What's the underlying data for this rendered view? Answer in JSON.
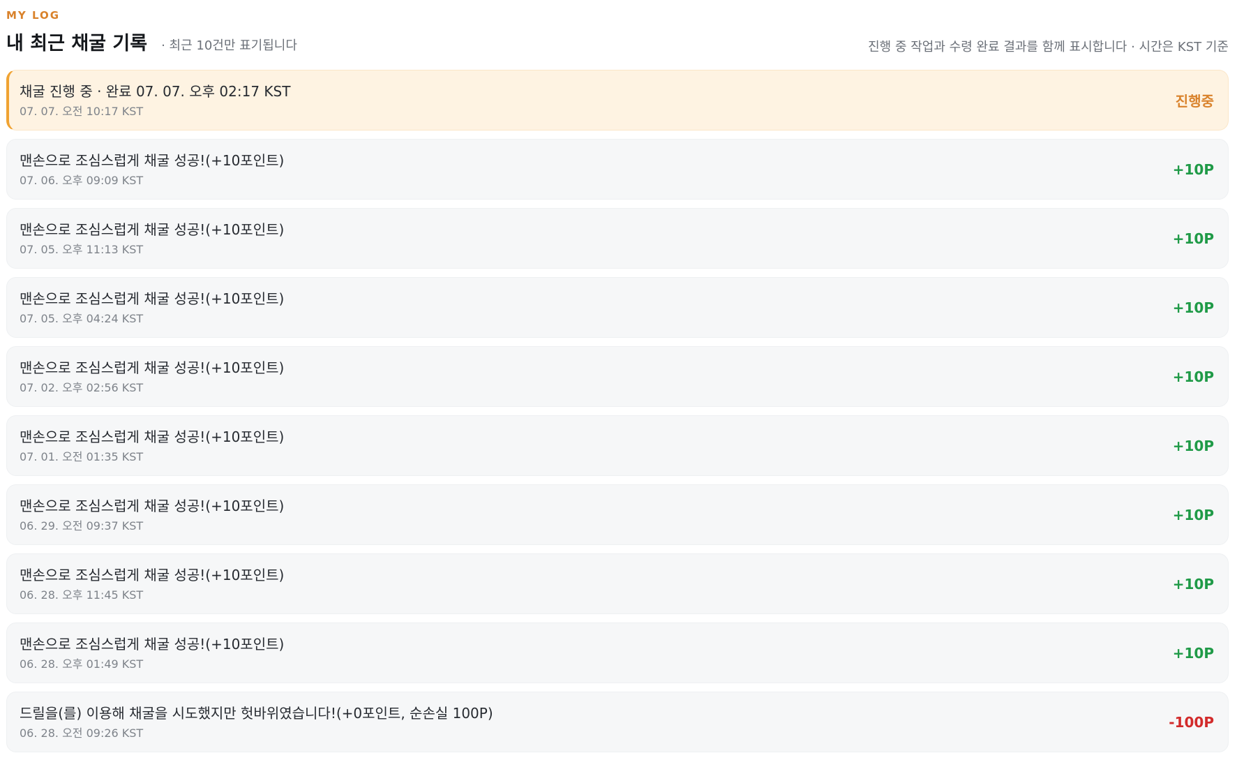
{
  "header": {
    "eyebrow": "MY LOG",
    "title": "내 최근 채굴 기록",
    "note": "· 최근 10건만 표기됩니다",
    "right_note": "진행 중 작업과 수령 완료 결과를 함께 표시합니다 · 시간은 KST 기준"
  },
  "logs": [
    {
      "message": "채굴 진행 중 · 완료 07. 07. 오후 02:17 KST",
      "time": "07. 07. 오전 10:17 KST",
      "badge": "진행중",
      "status": "in-progress"
    },
    {
      "message": "맨손으로 조심스럽게 채굴 성공!(+10포인트)",
      "time": "07. 06. 오후 09:09 KST",
      "badge": "+10P",
      "status": "plus"
    },
    {
      "message": "맨손으로 조심스럽게 채굴 성공!(+10포인트)",
      "time": "07. 05. 오후 11:13 KST",
      "badge": "+10P",
      "status": "plus"
    },
    {
      "message": "맨손으로 조심스럽게 채굴 성공!(+10포인트)",
      "time": "07. 05. 오후 04:24 KST",
      "badge": "+10P",
      "status": "plus"
    },
    {
      "message": "맨손으로 조심스럽게 채굴 성공!(+10포인트)",
      "time": "07. 02. 오후 02:56 KST",
      "badge": "+10P",
      "status": "plus"
    },
    {
      "message": "맨손으로 조심스럽게 채굴 성공!(+10포인트)",
      "time": "07. 01. 오전 01:35 KST",
      "badge": "+10P",
      "status": "plus"
    },
    {
      "message": "맨손으로 조심스럽게 채굴 성공!(+10포인트)",
      "time": "06. 29. 오전 09:37 KST",
      "badge": "+10P",
      "status": "plus"
    },
    {
      "message": "맨손으로 조심스럽게 채굴 성공!(+10포인트)",
      "time": "06. 28. 오후 11:45 KST",
      "badge": "+10P",
      "status": "plus"
    },
    {
      "message": "맨손으로 조심스럽게 채굴 성공!(+10포인트)",
      "time": "06. 28. 오후 01:49 KST",
      "badge": "+10P",
      "status": "plus"
    },
    {
      "message": "드릴을(를) 이용해 채굴을 시도했지만 헛바위였습니다!(+0포인트, 순손실 100P)",
      "time": "06. 28. 오전 09:26 KST",
      "badge": "-100P",
      "status": "minus"
    }
  ],
  "colors": {
    "accent": "#d9822b",
    "active_bg": "#fef3e2",
    "active_border": "#f0a332",
    "plus": "#1f9a47",
    "minus": "#d22b2b",
    "card_bg": "#f6f7f8"
  }
}
